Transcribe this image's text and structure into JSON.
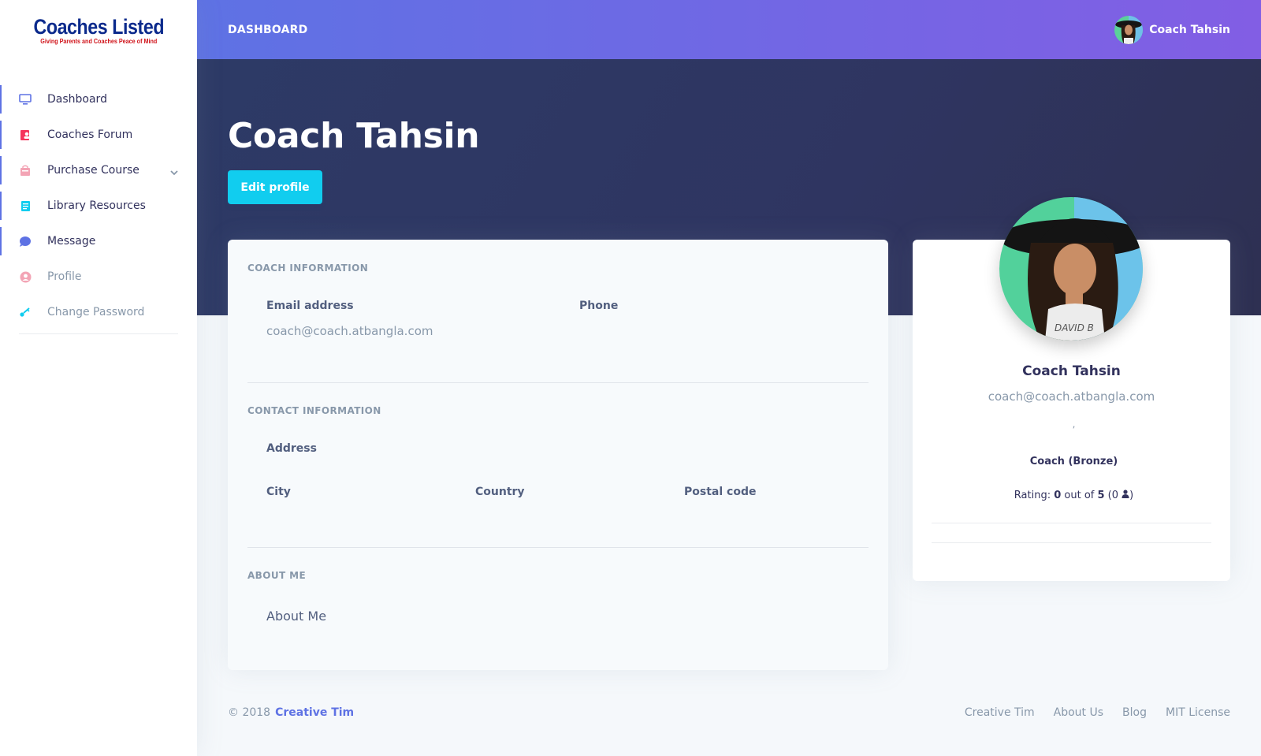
{
  "brand": {
    "title": "Coaches Listed",
    "tagline": "Giving Parents and Coaches Peace of Mind"
  },
  "sidebar": {
    "items": [
      {
        "label": "Dashboard",
        "icon": "tv-icon",
        "color": "#5e72e4"
      },
      {
        "label": "Coaches Forum",
        "icon": "forum-icon",
        "color": "#f5365c"
      },
      {
        "label": "Purchase Course",
        "icon": "bag-icon",
        "color": "#f3a4b5"
      },
      {
        "label": "Library Resources",
        "icon": "book-icon",
        "color": "#11cdef"
      },
      {
        "label": "Message",
        "icon": "chat-bubble-icon",
        "color": "#5e72e4"
      },
      {
        "label": "Profile",
        "icon": "user-circle-icon",
        "color": "#f3a4b5"
      },
      {
        "label": "Change Password",
        "icon": "key-icon",
        "color": "#11cdef"
      }
    ]
  },
  "topbar": {
    "title": "DASHBOARD",
    "user_name": "Coach Tahsin"
  },
  "header": {
    "name": "Coach Tahsin",
    "edit_button": "Edit profile"
  },
  "coach_info": {
    "heading": "COACH INFORMATION",
    "email_label": "Email address",
    "email_value": "coach@coach.atbangla.com",
    "phone_label": "Phone"
  },
  "contact_info": {
    "heading": "CONTACT INFORMATION",
    "address_label": "Address",
    "city_label": "City",
    "country_label": "Country",
    "postal_label": "Postal code"
  },
  "about": {
    "heading": "ABOUT ME",
    "value": "About Me"
  },
  "profile_card": {
    "name": "Coach Tahsin",
    "email": "coach@coach.atbangla.com",
    "location": ",",
    "role": "Coach (Bronze)",
    "rating_prefix": "Rating: ",
    "rating_value": "0",
    "rating_mid": " out of ",
    "rating_max": "5",
    "rating_open": " (0 ",
    "rating_close": ")"
  },
  "footer": {
    "copyright": "© 2018",
    "brand_link": "Creative Tim",
    "links": [
      "Creative Tim",
      "About Us",
      "Blog",
      "MIT License"
    ]
  },
  "colors": {
    "primary": "#5e72e4",
    "info": "#11cdef",
    "danger": "#f5365c",
    "header_bg": "#2d3a66"
  }
}
